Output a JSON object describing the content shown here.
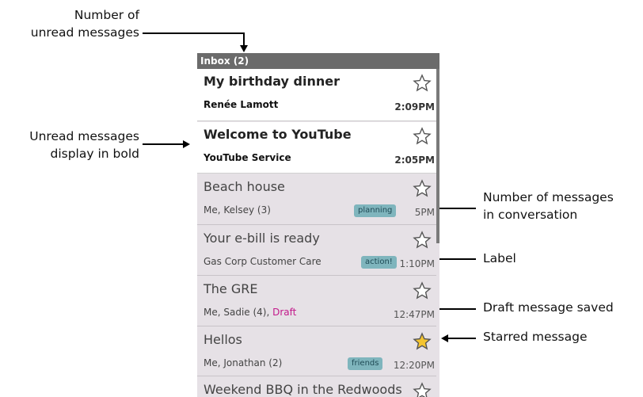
{
  "annotations": {
    "unread_count": "Number of\nunread messages",
    "bold_unread": "Unread messages\ndisplay in bold",
    "conversation_count": "Number of messages\nin conversation",
    "label": "Label",
    "draft_saved": "Draft message saved",
    "starred": "Starred message"
  },
  "inbox": {
    "title": "Inbox (2)",
    "messages": [
      {
        "subject": "My birthday dinner",
        "sender": "Renée Lamott",
        "time": "2:09PM",
        "unread": true,
        "starred": false
      },
      {
        "subject": "Welcome to YouTube",
        "sender": "YouTube Service",
        "time": "2:05PM",
        "unread": true,
        "starred": false
      },
      {
        "subject": "Beach house",
        "sender": "Me, Kelsey (3)",
        "label": "planning",
        "time": "5PM",
        "unread": false,
        "starred": false
      },
      {
        "subject": "Your e-bill is ready",
        "sender": "Gas Corp Customer Care",
        "label": "action!",
        "time": "1:10PM",
        "unread": false,
        "starred": false
      },
      {
        "subject": "The GRE",
        "sender": "Me, Sadie (4),",
        "draft": "Draft",
        "time": "12:47PM",
        "unread": false,
        "starred": false
      },
      {
        "subject": "Hellos",
        "sender": "Me, Jonathan (2)",
        "label": "friends",
        "time": "12:20PM",
        "unread": false,
        "starred": true
      },
      {
        "subject": "Weekend BBQ in the Redwoods",
        "sender": "",
        "time": "",
        "unread": false,
        "starred": false
      }
    ]
  },
  "colors": {
    "header_bg": "#6b6b6b",
    "read_bg": "#e6e1e6",
    "label_chip": "#7fb5bd",
    "draft": "#c2188a",
    "star_fill": "#f4c430"
  }
}
